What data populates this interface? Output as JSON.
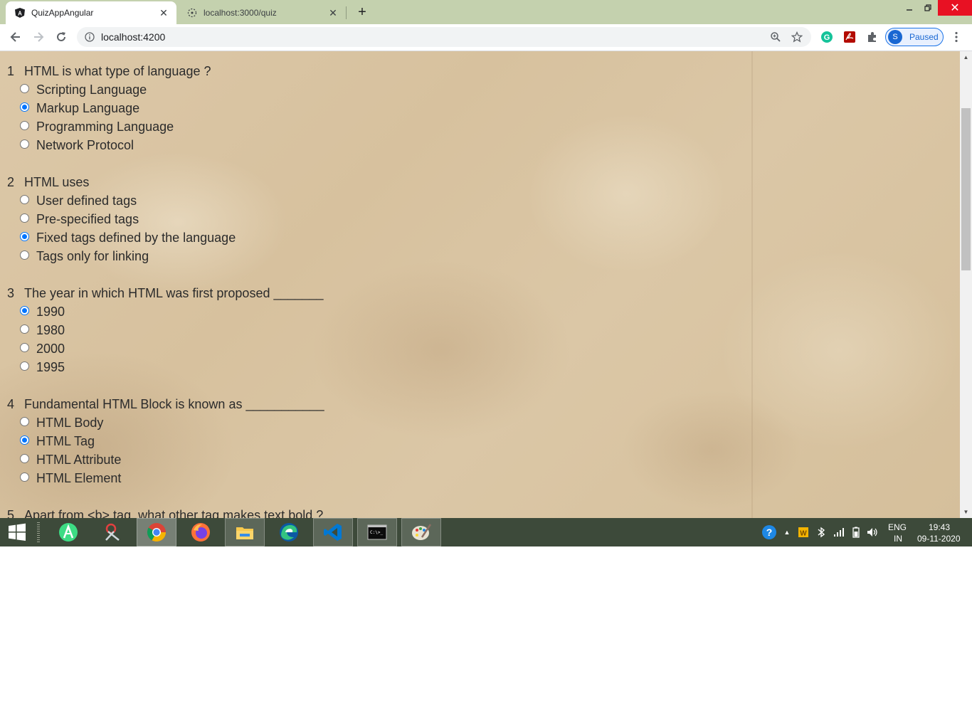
{
  "browser": {
    "tabs": [
      {
        "title": "QuizAppAngular",
        "favicon": "angular-icon",
        "active": true
      },
      {
        "title": "localhost:3000/quiz",
        "favicon": "page-loading-icon",
        "active": false
      }
    ],
    "address": "localhost:4200",
    "profile": {
      "initial": "S",
      "label": "Paused"
    }
  },
  "quiz": {
    "questions": [
      {
        "number": "1",
        "text": "HTML is what type of language ?",
        "options": [
          "Scripting Language",
          "Markup Language",
          "Programming Language",
          "Network Protocol"
        ],
        "selected": 1
      },
      {
        "number": "2",
        "text": "HTML uses",
        "options": [
          "User defined tags",
          "Pre-specified tags",
          "Fixed tags defined by the language",
          "Tags only for linking"
        ],
        "selected": 2
      },
      {
        "number": "3",
        "text": "The year in which HTML was first proposed _______",
        "options": [
          "1990",
          "1980",
          "2000",
          "1995"
        ],
        "selected": 0
      },
      {
        "number": "4",
        "text": "Fundamental HTML Block is known as ___________",
        "options": [
          "HTML Body",
          "HTML Tag",
          "HTML Attribute",
          "HTML Element"
        ],
        "selected": 1
      },
      {
        "number": "5",
        "text": "Apart from <b> tag, what other tag makes text bold ?"
      }
    ]
  },
  "taskbar": {
    "apps": [
      "android-studio-icon",
      "snipping-tool-icon",
      "chrome-icon",
      "firefox-icon",
      "file-explorer-icon",
      "edge-icon",
      "vscode-icon",
      "command-prompt-icon",
      "paint-icon"
    ],
    "language": "ENG",
    "region": "IN",
    "time": "19:43",
    "date": "09-11-2020"
  },
  "colors": {
    "tabbar": "#c4d1ae",
    "radio_accent": "#0075ff",
    "taskbar": "#3d4a3a",
    "close_button": "#e81123"
  }
}
